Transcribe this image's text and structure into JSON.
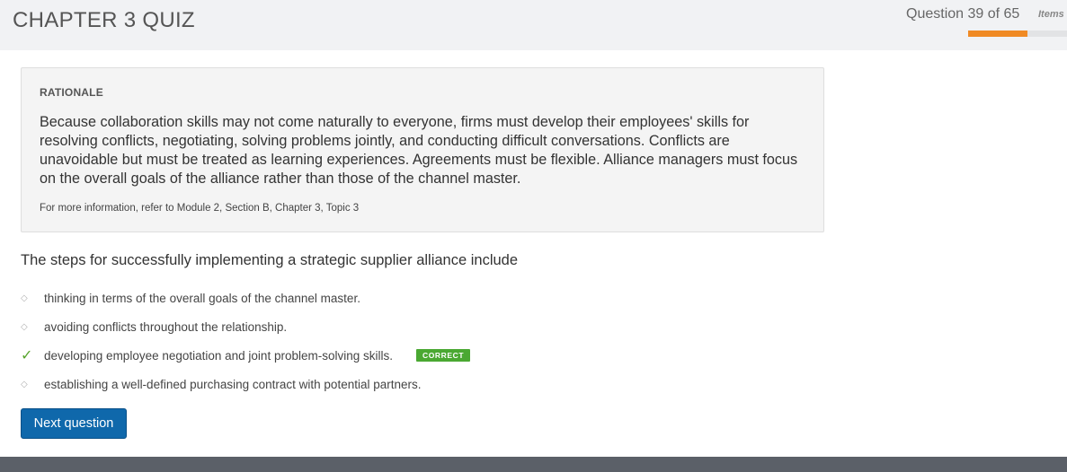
{
  "header": {
    "title": "CHAPTER 3 QUIZ",
    "progress_text": "Question 39 of 65",
    "items_label": "Items",
    "progress_fraction": 0.6,
    "progress_color": "#f08a24"
  },
  "rationale": {
    "heading": "RATIONALE",
    "body": "Because collaboration skills may not come naturally to everyone, firms must develop their employees' skills for resolving conflicts, negotiating, solving problems jointly, and conducting difficult conversations. Conflicts are unavoidable but must be treated as learning experiences. Agreements must be flexible. Alliance managers must focus on the overall goals of the alliance rather than those of the channel master.",
    "reference": "For more information, refer to Module 2, Section B, Chapter 3, Topic 3"
  },
  "question": {
    "text": "The steps for successfully implementing a strategic supplier alliance include",
    "options": [
      {
        "text": "thinking in terms of the overall goals of the channel master.",
        "marker": "diamond-icon",
        "correct": false
      },
      {
        "text": "avoiding conflicts throughout the relationship.",
        "marker": "diamond-icon",
        "correct": false
      },
      {
        "text": "developing employee negotiation and joint problem-solving skills.",
        "marker": "checkmark-icon",
        "correct": true,
        "badge": "CORRECT"
      },
      {
        "text": "establishing a well-defined purchasing contract with potential partners.",
        "marker": "diamond-icon",
        "correct": false
      }
    ]
  },
  "actions": {
    "next_label": "Next question"
  },
  "colors": {
    "accent_button": "#0f68ab",
    "correct_green": "#4aa832"
  }
}
